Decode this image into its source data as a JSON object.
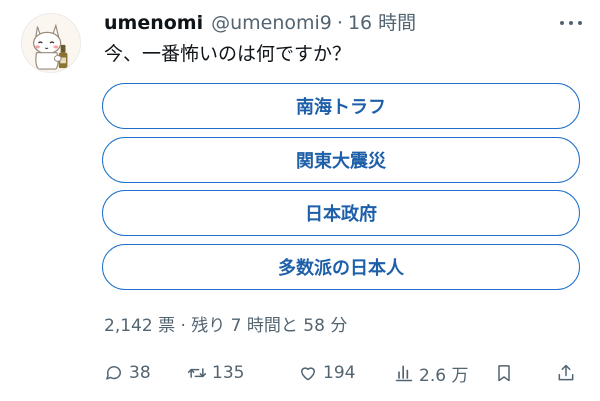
{
  "user": {
    "display_name": "umenomi",
    "handle": "@umenomi9",
    "separator": "·",
    "time": "16 時間"
  },
  "tweet": {
    "text": "今、一番怖いのは何ですか？"
  },
  "poll": {
    "options": [
      "南海トラフ",
      "関東大震災",
      "日本政府",
      "多数派の日本人"
    ],
    "info": "2,142 票 · 残り 7 時間と 58 分"
  },
  "actions": {
    "replies": "38",
    "retweets": "135",
    "likes": "194",
    "views": "2.6 万"
  },
  "icons": {
    "avatar": "cat-with-bottle-avatar",
    "more": "more-icon",
    "reply": "reply-icon",
    "retweet": "retweet-icon",
    "like": "heart-icon",
    "views": "views-icon",
    "bookmark": "bookmark-icon",
    "share": "share-icon"
  },
  "colors": {
    "text": "#0f1419",
    "secondary": "#536471",
    "poll_border": "#1d6fc9",
    "poll_text": "#1d5fa8"
  }
}
